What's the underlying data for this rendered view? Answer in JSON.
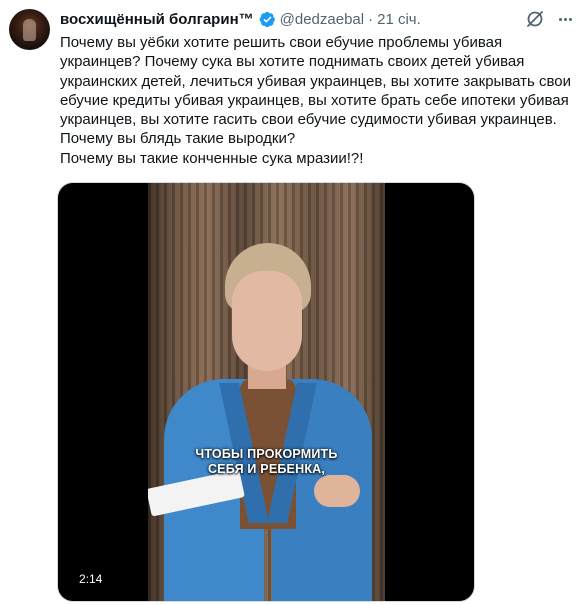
{
  "author": {
    "display_name": "восхищённый болгарин™",
    "handle": "@dedzaebal",
    "separator": "·",
    "time": "21 січ.",
    "verified": true
  },
  "icons": {
    "avatar": "user-avatar",
    "verified": "verified-badge-icon",
    "grok": "grok-icon",
    "more": "more-icon"
  },
  "colors": {
    "verified": "#1d9bf0",
    "text": "#0f1419",
    "secondary": "#536471"
  },
  "tweet": {
    "lines": [
      "Почему вы уёбки хотите решить свои ебучие проблемы убивая",
      "украинцев? Почему сука вы хотите поднимать своих детей убивая",
      "украинских детей, лечиться убивая украинцев, вы хотите закрывать свои",
      "ебучие кредиты убивая украинцев, вы хотите брать себе ипотеки убивая",
      "украинцев, вы хотите гасить свои ебучие судимости убивая украинцев.",
      "Почему вы блядь такие выродки?",
      "Почему вы такие конченные сука мразии!?!"
    ]
  },
  "media": {
    "caption_lines": [
      "ЧТОБЫ ПРОКОРМИТЬ",
      "СЕБЯ И РЕБЕНКА,"
    ],
    "duration": "2:14"
  }
}
